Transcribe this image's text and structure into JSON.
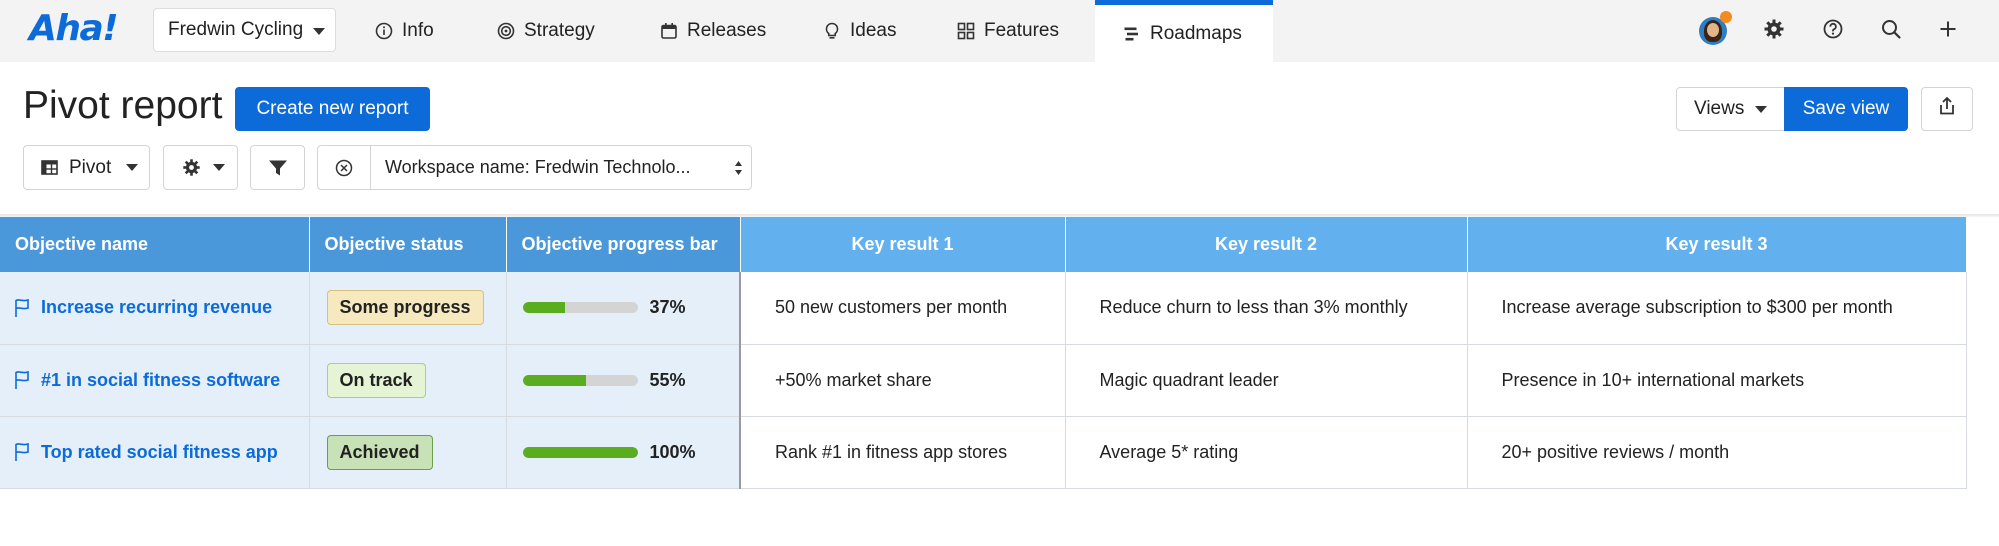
{
  "app": {
    "logo": "Aha!",
    "workspace": "Fredwin Cycling",
    "tabs": [
      {
        "label": "Info",
        "icon": "info-icon"
      },
      {
        "label": "Strategy",
        "icon": "target-icon"
      },
      {
        "label": "Releases",
        "icon": "calendar-icon"
      },
      {
        "label": "Ideas",
        "icon": "lightbulb-icon"
      },
      {
        "label": "Features",
        "icon": "grid-icon"
      },
      {
        "label": "Roadmaps",
        "icon": "roadmap-icon",
        "active": true
      }
    ],
    "right_icons": [
      "avatar",
      "gear-icon",
      "help-icon",
      "search-icon",
      "plus-icon"
    ],
    "accent": "#0c6bd8",
    "notification_color": "#f58a1f"
  },
  "header": {
    "title": "Pivot report",
    "create_label": "Create new report",
    "views_label": "Views",
    "save_view_label": "Save view"
  },
  "toolbar": {
    "pivot_label": "Pivot",
    "filter_text": "Workspace name: Fredwin Technolo..."
  },
  "table": {
    "headers": [
      "Objective name",
      "Objective status",
      "Objective progress bar",
      "Key result 1",
      "Key result 2",
      "Key result 3"
    ],
    "header_colors": {
      "dark": "#4a98da",
      "light": "#62b1ee"
    },
    "rows": [
      {
        "name": "Increase recurring revenue",
        "status": "Some progress",
        "status_colors": {
          "bg": "#f6e9bf",
          "border": "#d6c27e"
        },
        "progress": 0.37,
        "progress_label": "37%",
        "kr1": "50 new customers per month",
        "kr2": "Reduce churn to less than 3% monthly",
        "kr3": "Increase average subscription to $300 per month"
      },
      {
        "name": "#1 in social fitness software",
        "status": "On track",
        "status_colors": {
          "bg": "#e5f4d4",
          "border": "#a6d17f"
        },
        "progress": 0.55,
        "progress_label": "55%",
        "kr1": "+50% market share",
        "kr2": "Magic quadrant leader",
        "kr3": "Presence in 10+ international markets"
      },
      {
        "name": "Top rated social fitness app",
        "status": "Achieved",
        "status_colors": {
          "bg": "#c9e1b6",
          "border": "#6b9e48"
        },
        "progress": 1.0,
        "progress_label": "100%",
        "kr1": "Rank #1 in fitness app stores",
        "kr2": "Average 5* rating",
        "kr3": "20+ positive reviews / month"
      }
    ]
  }
}
